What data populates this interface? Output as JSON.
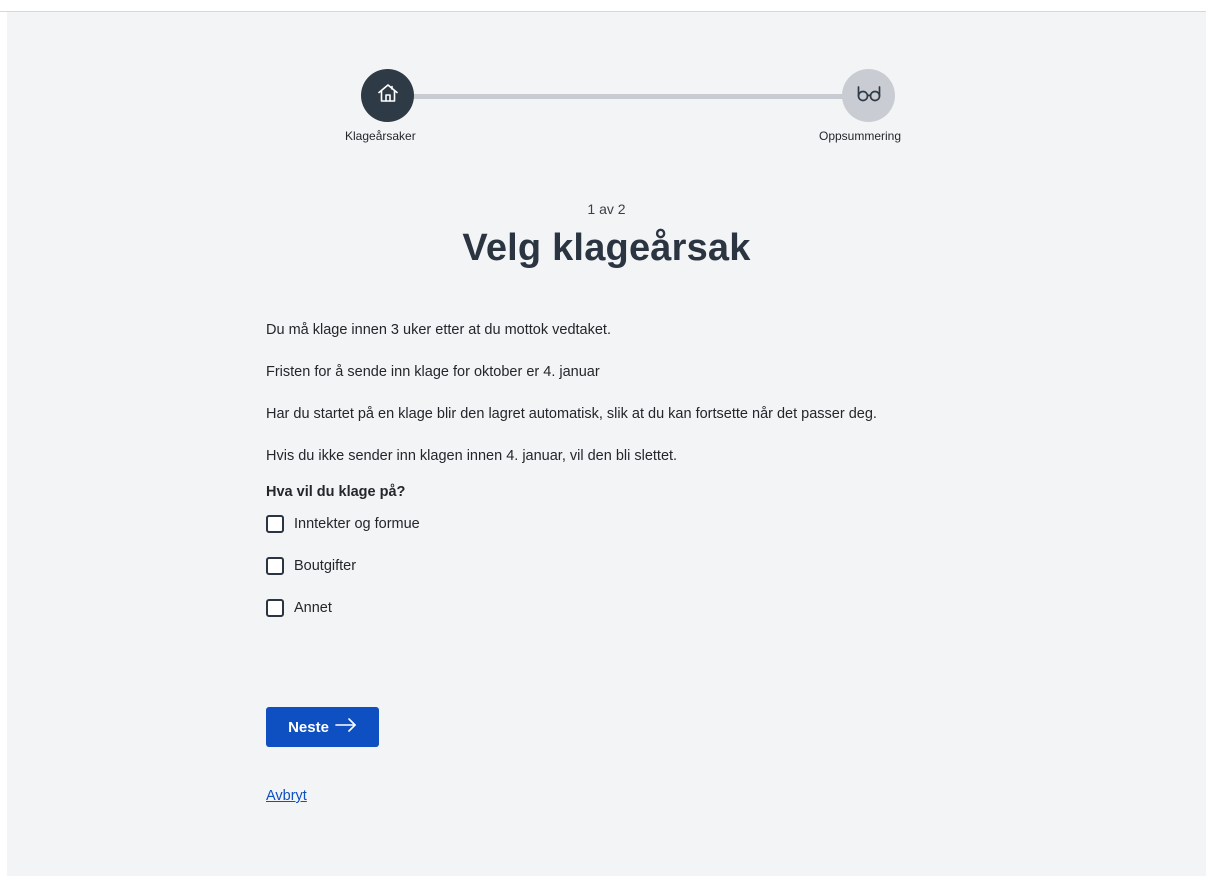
{
  "stepper": {
    "steps": [
      {
        "label": "Klageårsaker",
        "icon": "house-icon",
        "state": "active"
      },
      {
        "label": "Oppsummering",
        "icon": "glasses-icon",
        "state": "inactive"
      }
    ]
  },
  "header": {
    "step_counter": "1 av 2",
    "title": "Velg klageårsak"
  },
  "main": {
    "paragraphs": [
      "Du må klage innen 3 uker etter at du mottok vedtaket.",
      "Fristen for å sende inn klage for oktober er 4. januar",
      "Har du startet på en klage blir den lagret automatisk, slik at du kan fortsette når det passer deg.",
      "Hvis du ikke sender inn klagen innen 4. januar, vil den bli slettet."
    ],
    "question": "Hva vil du klage på?",
    "options": [
      {
        "label": "Inntekter og formue",
        "checked": false
      },
      {
        "label": "Boutgifter",
        "checked": false
      },
      {
        "label": "Annet",
        "checked": false
      }
    ]
  },
  "actions": {
    "next_label": "Neste",
    "next_icon": "arrow-right-icon",
    "cancel_label": "Avbryt"
  },
  "colors": {
    "primary": "#0e4fc2",
    "active_step": "#2f3a47",
    "inactive_step": "#c9cdd3",
    "background": "#f3f4f6"
  }
}
